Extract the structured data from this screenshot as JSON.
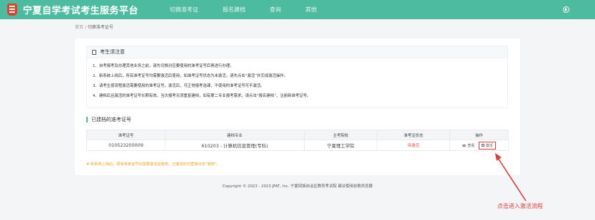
{
  "header": {
    "title": "宁夏自学考试考生服务平台",
    "nav": [
      "切换准考证",
      "报名建档",
      "查询",
      "其他"
    ],
    "accent_color": "#4cbba0"
  },
  "breadcrumb": {
    "home": "首页",
    "separator": "/",
    "current": "切换准考证号"
  },
  "notice": {
    "title": "考生须注意",
    "lines": [
      "1、自考报考及办理其他业务之前，请先切换对应要使用的准考证号后再进行办理。",
      "2、新系统上线后，所有准考证号均需要激活后使用，如准考证号状态为未激活，请先点击“激活”并完成激活操作。",
      "3、请考生按流程激活需要使用的准考证号，激活后，可正常报考选课，不使用的准考证号可不激活。",
      "4、建档后且激活的准考证号长期有效，当次报考无须重复建档，如有第二专业报考需求，请点击“报名建档”，注册新准考证号。"
    ]
  },
  "section": {
    "title": "已建档的准考证号"
  },
  "table": {
    "columns": [
      "准考证号",
      "建档专业",
      "主考院校",
      "准考证状态",
      "操作"
    ],
    "rows": [
      {
        "id": "010523200009",
        "major": "610203 - 计算机信息管理(专科)",
        "school": "宁夏理工学院",
        "status": "待激活",
        "view_label": "查看",
        "activate_label": "激活"
      }
    ]
  },
  "tip": "# 新系统上线后，原有准考证号均需要激活后使用，已激活的可直接点击“使用”。",
  "footer": "Copyright © 2023 - 2023 JFAT, Inc. 宁夏回族自治区教育考试院 建议使用谷歌浏览器",
  "annotation": "点击进入激活流程",
  "colors": {
    "pending": "#f04d48",
    "annotation": "#e53935",
    "tip": "#f0a020"
  }
}
